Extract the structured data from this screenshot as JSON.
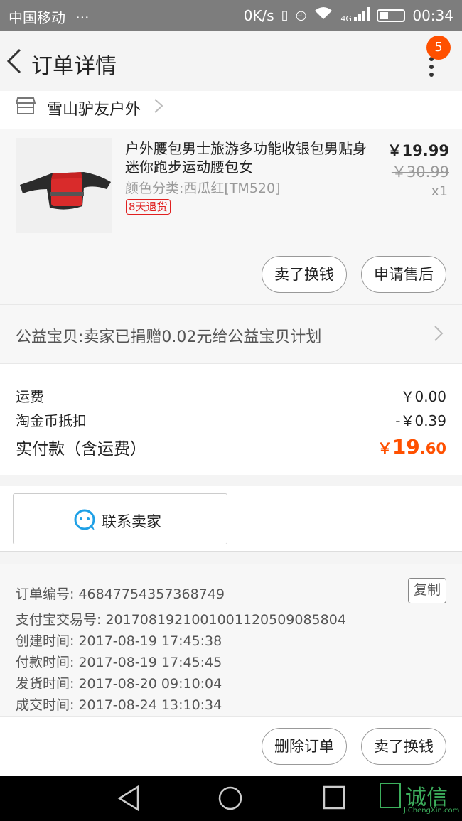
{
  "status_bar": {
    "carrier": "中国移动",
    "more": "···",
    "speed": "0K/s",
    "network": "4G",
    "time": "00:34"
  },
  "header": {
    "title": "订单详情",
    "badge_count": "5"
  },
  "shop": {
    "name": "雪山驴友户外"
  },
  "product": {
    "title": "户外腰包男士旅游多功能收银包男贴身迷你跑步运动腰包女",
    "spec": "颜色分类:西瓜红[TM520]",
    "tag": "8天退货",
    "price": "￥19.99",
    "original_price": "￥30.99",
    "quantity": "x1",
    "buttons": [
      "卖了换钱",
      "申请售后"
    ]
  },
  "charity": {
    "text": "公益宝贝:卖家已捐赠0.02元给公益宝贝计划"
  },
  "fees": {
    "shipping_label": "运费",
    "shipping_value": "￥0.00",
    "coin_label": "淘金币抵扣",
    "coin_value": "-￥0.39",
    "paid_label": "实付款（含运费）",
    "paid_currency": "￥",
    "paid_integer": "19",
    "paid_decimal": ".60"
  },
  "contact": {
    "label": "联系卖家"
  },
  "order_info": {
    "copy_label": "复制",
    "lines": [
      "订单编号: 46847754357368749",
      "支付宝交易号: 2017081921001001120509085804",
      "创建时间: 2017-08-19 17:45:38",
      "付款时间: 2017-08-19 17:45:45",
      "发货时间: 2017-08-20 09:10:04",
      "成交时间: 2017-08-24 13:10:34"
    ]
  },
  "bottom_buttons": [
    "删除订单",
    "卖了换钱"
  ],
  "watermark": {
    "text": "诚信",
    "sub": "JiChengXin.com"
  },
  "colors": {
    "accent": "#ff5000",
    "tag_red": "#e02020",
    "contact_blue": "#1ea0e6",
    "watermark_green": "#3cae5c"
  }
}
